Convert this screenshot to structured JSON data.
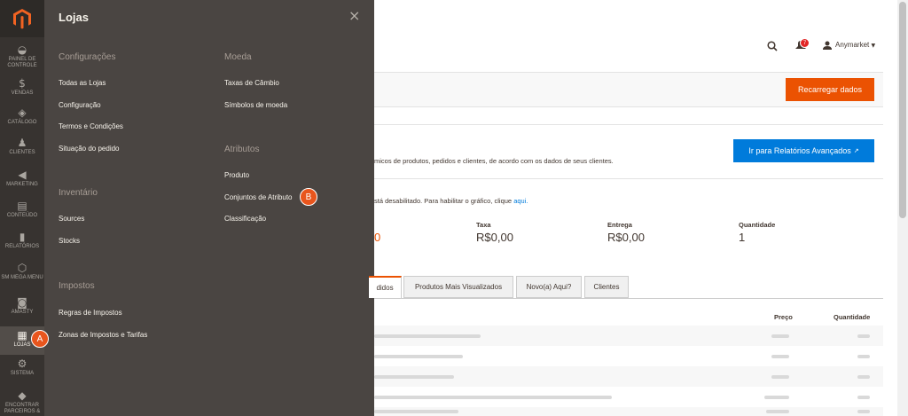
{
  "nav": {
    "items": [
      {
        "label": "PAINEL DE CONTROLE",
        "icon": "dashboard-icon"
      },
      {
        "label": "VENDAS",
        "icon": "dollar-icon"
      },
      {
        "label": "CATÁLOGO",
        "icon": "cube-icon"
      },
      {
        "label": "CLIENTES",
        "icon": "person-icon"
      },
      {
        "label": "MARKETING",
        "icon": "megaphone-icon"
      },
      {
        "label": "CONTEÚDO",
        "icon": "layout-icon"
      },
      {
        "label": "RELATÓRIOS",
        "icon": "bar-chart-icon"
      },
      {
        "label": "SM MEGA MENU",
        "icon": "hexagon-icon"
      },
      {
        "label": "AMASTY",
        "icon": "amasty-icon"
      },
      {
        "label": "LOJAS",
        "icon": "store-icon"
      },
      {
        "label": "SISTEMA",
        "icon": "gear-icon"
      },
      {
        "label": "ENCONTRAR PARCEIROS &",
        "icon": "box-icon"
      }
    ]
  },
  "panel": {
    "title": "Lojas",
    "close": "×",
    "sections": {
      "config": "Configurações",
      "inventory": "Inventário",
      "taxes": "Impostos",
      "currency": "Moeda",
      "attributes": "Atributos"
    },
    "links": {
      "all_stores": "Todas as Lojas",
      "configuration": "Configuração",
      "terms": "Termos e Condições",
      "order_status": "Situação do pedido",
      "sources": "Sources",
      "stocks": "Stocks",
      "tax_rules": "Regras de Impostos",
      "tax_zones": "Zonas de Impostos e Tarifas",
      "rates": "Taxas de Câmbio",
      "symbols": "Símbolos de moeda",
      "product": "Produto",
      "attribute_sets": "Conjuntos de Atributo",
      "rating": "Classificação"
    }
  },
  "header": {
    "user": "Anymarket",
    "notifications_count": "7"
  },
  "page": {
    "reload_button": "Recarregar dados",
    "advanced_reports_button": "Ir para Relatórios Avançados",
    "description": "micos de produtos, pedidos e clientes, de acordo com os dados de seus clientes.",
    "chart_notice": "stá desabilitado. Para habilitar o gráfico, clique",
    "chart_notice_link": "aqui.",
    "stats": [
      {
        "label": "Taxa",
        "value": "R$0,00"
      },
      {
        "label": "Entrega",
        "value": "R$0,00"
      },
      {
        "label": "Quantidade",
        "value": "1"
      }
    ],
    "partial_stat_value": "0",
    "tabs": [
      "didos",
      "Produtos Mais Visualizados",
      "Novo(a) Aqui?",
      "Clientes"
    ],
    "columns": {
      "price": "Preço",
      "quantity": "Quantidade"
    }
  },
  "annotations": {
    "a": "A",
    "b": "B"
  },
  "colors": {
    "accent": "#eb5202",
    "link_blue": "#007bdb",
    "nav_bg": "#373330",
    "panel_bg": "#4a4542"
  }
}
